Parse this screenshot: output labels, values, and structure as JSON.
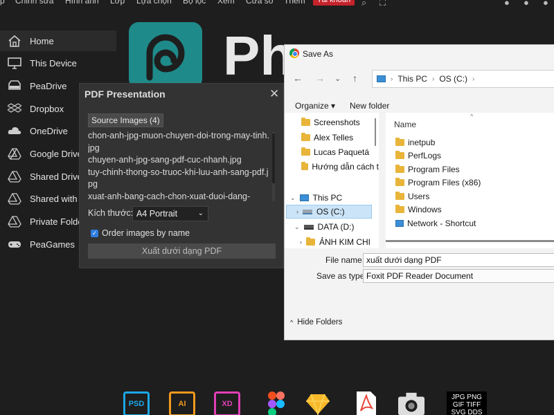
{
  "menubar": {
    "items": [
      "p",
      "Chỉnh sửa",
      "Hình ảnh",
      "Lớp",
      "Lựa chọn",
      "Bộ lọc",
      "Xem",
      "Cửa sổ",
      "Thêm"
    ],
    "account": "Tài khoản"
  },
  "sidebar": {
    "items": [
      {
        "label": "Home",
        "icon": "home-icon"
      },
      {
        "label": "This Device",
        "icon": "monitor-icon"
      },
      {
        "label": "PeaDrive",
        "icon": "drive-icon"
      },
      {
        "label": "Dropbox",
        "icon": "dropbox-icon"
      },
      {
        "label": "OneDrive",
        "icon": "cloud-icon"
      },
      {
        "label": "Google Drive",
        "icon": "google-drive-icon"
      },
      {
        "label": "Shared Drive",
        "icon": "shared-drive-icon"
      },
      {
        "label": "Shared with me",
        "icon": "shared-icon"
      },
      {
        "label": "Private Folder",
        "icon": "private-folder-icon"
      },
      {
        "label": "PeaGames",
        "icon": "gamepad-icon"
      }
    ]
  },
  "logo": {
    "text": "Ph"
  },
  "pdf_panel": {
    "title": "PDF Presentation",
    "source_button": "Source Images (4)",
    "files": [
      "chon-anh-jpg-muon-chuyen-doi-trong-may-tinh.jpg",
      "chuyen-anh-jpg-sang-pdf-cuc-nhanh.jpg",
      "tuy-chinh-thong-so-truoc-khi-luu-anh-sang-pdf.jpg",
      "xuat-anh-bang-cach-chon-xuat-duoi-dang-"
    ],
    "size_label": "Kích thước:",
    "size_value": "A4 Portrait",
    "order_label": "Order images by name",
    "order_checked": true,
    "export_button": "Xuất dưới dạng PDF"
  },
  "save_dialog": {
    "title": "Save As",
    "path": [
      "This PC",
      "OS (C:)"
    ],
    "organize": "Organize",
    "new_folder": "New folder",
    "tree": [
      {
        "label": "Screenshots",
        "type": "folder"
      },
      {
        "label": "Alex Telles",
        "type": "folder"
      },
      {
        "label": "Lucas Paquetá",
        "type": "folder"
      },
      {
        "label": "Hướng dẫn cách t",
        "type": "folder"
      },
      {
        "label": "This PC",
        "type": "pc"
      },
      {
        "label": "OS (C:)",
        "type": "drive"
      },
      {
        "label": "DATA (D:)",
        "type": "drive"
      },
      {
        "label": "ẢNH KIM CHI",
        "type": "folder"
      }
    ],
    "column_header": "Name",
    "files": [
      "inetpub",
      "PerfLogs",
      "Program Files",
      "Program Files (x86)",
      "Users",
      "Windows",
      "Network - Shortcut"
    ],
    "file_name_label": "File name:",
    "file_name_value": "xuất dưới dạng PDF",
    "save_type_label": "Save as type:",
    "save_type_value": "Foxit PDF Reader Document",
    "hide_folders": "Hide Folders"
  },
  "formats": [
    {
      "label": "PSD",
      "color": "#1aa7e6"
    },
    {
      "label": "AI",
      "color": "#f39a1d"
    },
    {
      "label": "XD",
      "color": "#e23eb7"
    },
    {
      "label": "",
      "color": "#f24e1e"
    },
    {
      "label": "",
      "color": "#f7b92b"
    },
    {
      "label": "",
      "color": "#e8473b"
    },
    {
      "label": "",
      "color": "#dddddd"
    },
    {
      "label": "JPG PNG GIF TIFF SVG DDS",
      "color": "#ffffff"
    }
  ]
}
